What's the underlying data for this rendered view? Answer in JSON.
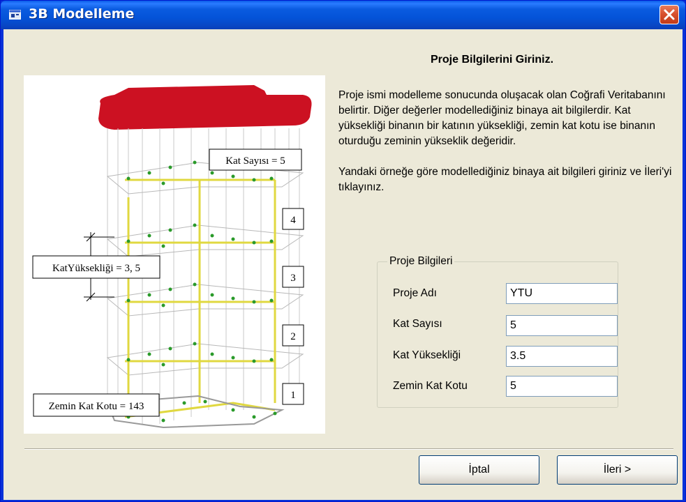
{
  "window": {
    "title": "3B Modelleme",
    "title_icon": "app-window-icon",
    "close_icon": "close-icon"
  },
  "heading": "Proje Bilgilerini Giriniz.",
  "description": {
    "paragraph1": "Proje ismi modelleme sonucunda oluşacak olan Coğrafi Veritabanını belirtir. Diğer değerler modellediğiniz binaya ait bilgilerdir. Kat yüksekliği binanın bir katının yüksekliği, zemin kat kotu ise binanın oturduğu zeminin yükseklik değeridir.",
    "paragraph2": "Yandaki örneğe göre modellediğiniz binaya ait bilgileri giriniz ve İleri'yi tıklayınız."
  },
  "diagram": {
    "kat_sayisi_label": "Kat Sayısı = 5",
    "kat_yuksekligi_label": "KatYüksekliği = 3, 5",
    "zemin_kat_kotu_label": "Zemin Kat Kotu = 143",
    "floor_numbers": [
      "4",
      "3",
      "2",
      "1"
    ]
  },
  "group": {
    "legend": "Proje Bilgileri",
    "fields": [
      {
        "label": "Proje Adı",
        "value": "YTU"
      },
      {
        "label": "Kat Sayısı",
        "value": "5"
      },
      {
        "label": "Kat Yüksekliği",
        "value": "3.5"
      },
      {
        "label": "Zemin Kat Kotu",
        "value": "5"
      }
    ]
  },
  "buttons": {
    "cancel": "İptal",
    "next": "İleri >"
  },
  "colors": {
    "titlebar": "#0a5be0",
    "close_button": "#d8512f",
    "roof": "#cc1122",
    "columns": "#e8e060",
    "joints": "#2a9a2a"
  }
}
